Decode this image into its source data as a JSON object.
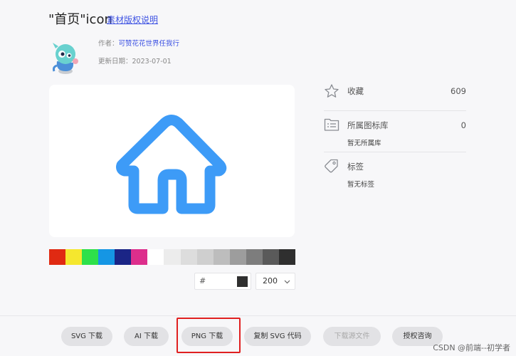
{
  "header": {
    "title": "\"首页\"icon",
    "copyright_link": "素材版权说明",
    "author_label": "作者：",
    "author_name": "可赞花花世界任我行",
    "updated_label": "更新日期：",
    "updated_date": "2023-07-01"
  },
  "preview": {
    "icon": "house-icon",
    "icon_color": "#3d9bf7"
  },
  "swatches": [
    "#e02a12",
    "#f5e72e",
    "#2ee04a",
    "#1596e4",
    "#1b2586",
    "#dd2e8c",
    "#ffffff",
    "#ececec",
    "#dddddd",
    "#cfcfcf",
    "#bdbdbd",
    "#9d9d9d",
    "#7d7d7d",
    "#5a5a5a",
    "#2f2f2f"
  ],
  "color_input": {
    "prefix": "#",
    "value": "",
    "current_color": "#2f2f2f"
  },
  "size_select": {
    "value": "200"
  },
  "panel": {
    "favorites_label": "收藏",
    "favorites_count": "609",
    "library_label": "所属图标库",
    "library_count": "0",
    "library_sub": "暂无所属库",
    "tags_label": "标签",
    "tags_sub": "暂无标签"
  },
  "footer": {
    "buttons": [
      {
        "label": "SVG 下载"
      },
      {
        "label": "AI 下载"
      },
      {
        "label": "PNG 下载"
      },
      {
        "label": "复制 SVG 代码"
      },
      {
        "label": "下载源文件",
        "disabled": true
      },
      {
        "label": "授权咨询"
      }
    ]
  },
  "watermark": "CSDN @前端--初学者"
}
